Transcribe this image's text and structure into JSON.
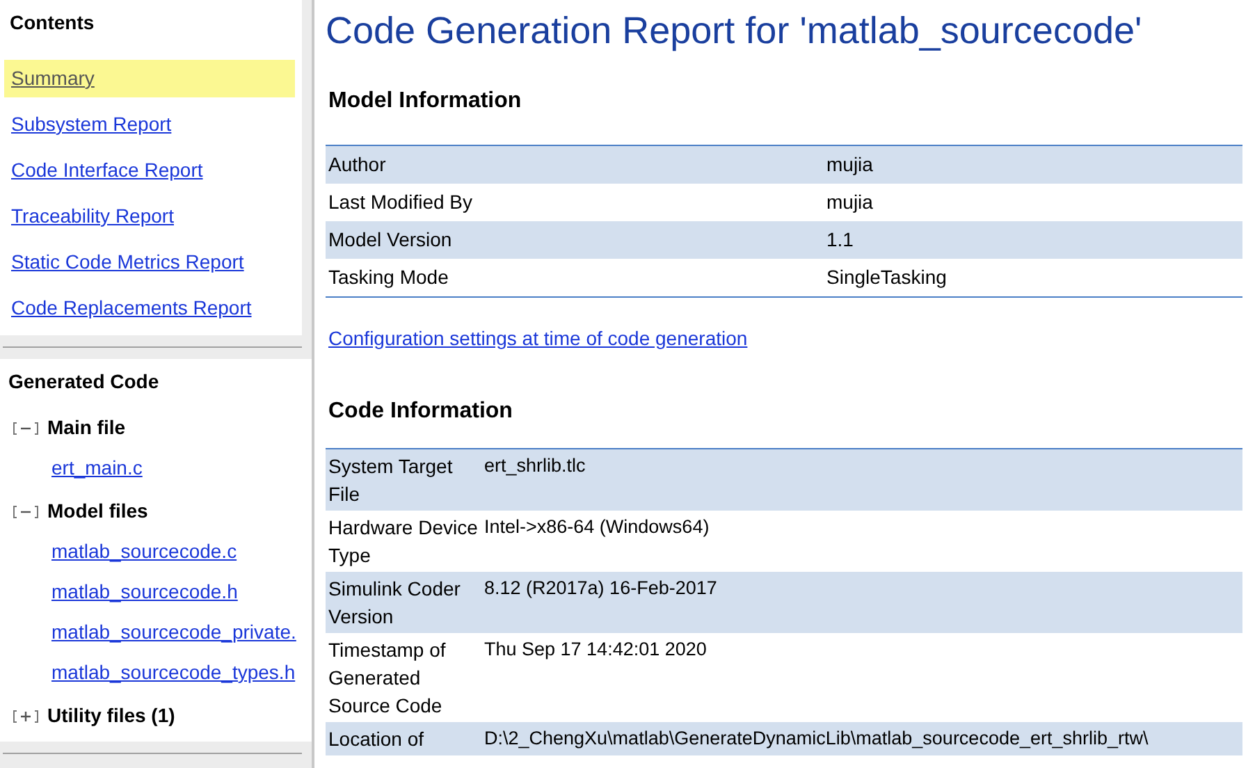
{
  "sidebar": {
    "contents": {
      "title": "Contents",
      "items": [
        {
          "label": "Summary",
          "selected": true
        },
        {
          "label": "Subsystem Report",
          "selected": false
        },
        {
          "label": "Code Interface Report",
          "selected": false
        },
        {
          "label": "Traceability Report",
          "selected": false
        },
        {
          "label": "Static Code Metrics Report",
          "selected": false
        },
        {
          "label": "Code Replacements Report",
          "selected": false
        }
      ]
    },
    "generated_code": {
      "title": "Generated Code",
      "groups": [
        {
          "label": "Main file",
          "expanded": true,
          "children": [
            "ert_main.c"
          ]
        },
        {
          "label": "Model files",
          "expanded": true,
          "children": [
            "matlab_sourcecode.c",
            "matlab_sourcecode.h",
            "matlab_sourcecode_private.",
            "matlab_sourcecode_types.h"
          ]
        },
        {
          "label": "Utility files (1)",
          "expanded": false
        }
      ]
    }
  },
  "main": {
    "title": "Code Generation Report for 'matlab_sourcecode'",
    "model_information": {
      "heading": "Model Information",
      "rows": [
        {
          "label": "Author",
          "value": "mujia"
        },
        {
          "label": "Last Modified By",
          "value": "mujia"
        },
        {
          "label": "Model Version",
          "value": "1.1"
        },
        {
          "label": "Tasking Mode",
          "value": "SingleTasking"
        }
      ],
      "link": "Configuration settings at time of code generation"
    },
    "code_information": {
      "heading": "Code Information",
      "rows": [
        {
          "label": "System Target File",
          "value": "ert_shrlib.tlc"
        },
        {
          "label": "Hardware Device Type",
          "value": "Intel->x86-64 (Windows64)"
        },
        {
          "label": "Simulink Coder Version",
          "value": "8.12 (R2017a) 16-Feb-2017"
        },
        {
          "label": "Timestamp of Generated Source Code",
          "value": "Thu Sep 17 14:42:01 2020"
        },
        {
          "label": "Location of",
          "value": "D:\\2_ChengXu\\matlab\\GenerateDynamicLib\\matlab_sourcecode_ert_shrlib_rtw\\"
        }
      ]
    }
  }
}
